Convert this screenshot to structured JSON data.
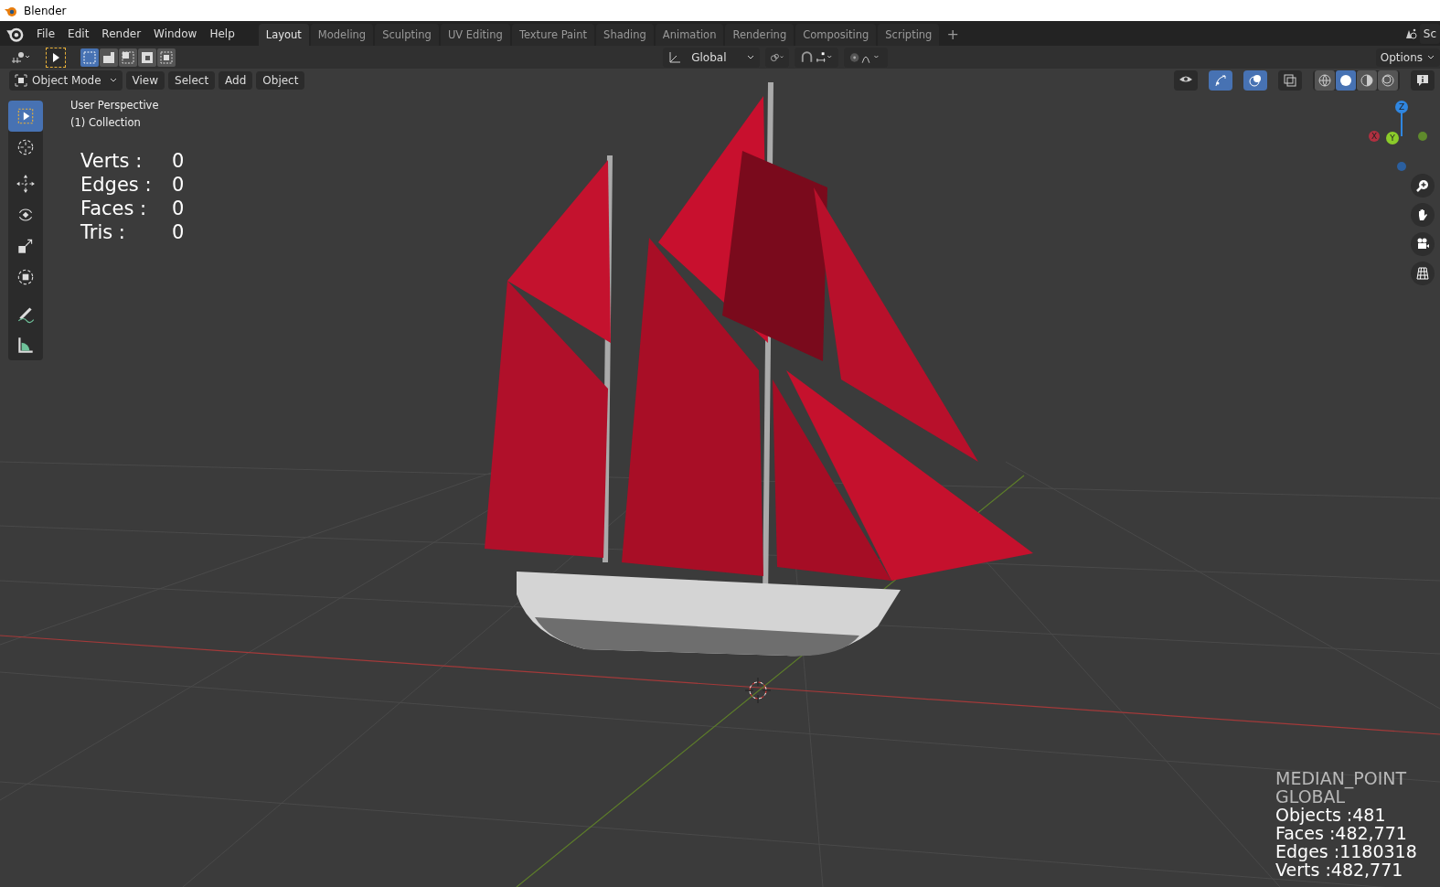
{
  "window": {
    "title": "Blender"
  },
  "menu": [
    "File",
    "Edit",
    "Render",
    "Window",
    "Help"
  ],
  "workspaces": [
    {
      "label": "Layout",
      "selected": true
    },
    {
      "label": "Modeling",
      "selected": false
    },
    {
      "label": "Sculpting",
      "selected": false
    },
    {
      "label": "UV Editing",
      "selected": false
    },
    {
      "label": "Texture Paint",
      "selected": false
    },
    {
      "label": "Shading",
      "selected": false
    },
    {
      "label": "Animation",
      "selected": false
    },
    {
      "label": "Rendering",
      "selected": false
    },
    {
      "label": "Compositing",
      "selected": false
    },
    {
      "label": "Scripting",
      "selected": false
    }
  ],
  "add_workspace": "+",
  "scene": "Sc",
  "select_modes": [
    {
      "kind": "set",
      "selected": true
    },
    {
      "kind": "extend",
      "selected": false
    },
    {
      "kind": "subtract",
      "selected": false
    },
    {
      "kind": "invert",
      "selected": false
    },
    {
      "kind": "intersect",
      "selected": false
    }
  ],
  "transform_orientation": "Global",
  "options": "Options",
  "viewport_header": {
    "mode": "Object Mode",
    "menus": [
      "View",
      "Select",
      "Add",
      "Object"
    ]
  },
  "viewport_toggles": [
    {
      "kind": "visibility",
      "selected": false
    },
    {
      "kind": "gizmo",
      "selected": true
    },
    {
      "kind": "overlay",
      "selected": true
    },
    {
      "kind": "xray",
      "selected": false
    }
  ],
  "shading_modes": [
    {
      "kind": "wireframe",
      "selected": false
    },
    {
      "kind": "solid",
      "selected": true
    },
    {
      "kind": "material",
      "selected": false
    },
    {
      "kind": "rendered",
      "selected": false
    }
  ],
  "overlay_text": {
    "view": "User Perspective",
    "collection": "(1) Collection"
  },
  "stats": [
    {
      "label": "Verts :",
      "value": "0"
    },
    {
      "label": "Edges :",
      "value": "0"
    },
    {
      "label": "Faces :",
      "value": "0"
    },
    {
      "label": "Tris :",
      "value": "0"
    }
  ],
  "tools": [
    {
      "kind": "select",
      "selected": true
    },
    {
      "kind": "cursor",
      "selected": false
    },
    {
      "kind": "move",
      "selected": false
    },
    {
      "kind": "rotate",
      "selected": false
    },
    {
      "kind": "scale",
      "selected": false
    },
    {
      "kind": "transform",
      "selected": false
    },
    {
      "kind": "annotate",
      "selected": false
    },
    {
      "kind": "measure",
      "selected": false
    }
  ],
  "gizmo": {
    "z": "Z",
    "y": "Y",
    "x": "X"
  },
  "info": [
    {
      "text": "MEDIAN_POINT",
      "dim": true
    },
    {
      "text": "GLOBAL",
      "dim": true
    },
    {
      "text": "Objects :481",
      "dim": false
    },
    {
      "text": "Faces :482,771",
      "dim": false
    },
    {
      "text": "Edges :1180318",
      "dim": false
    },
    {
      "text": "Verts :482,771",
      "dim": false
    }
  ]
}
